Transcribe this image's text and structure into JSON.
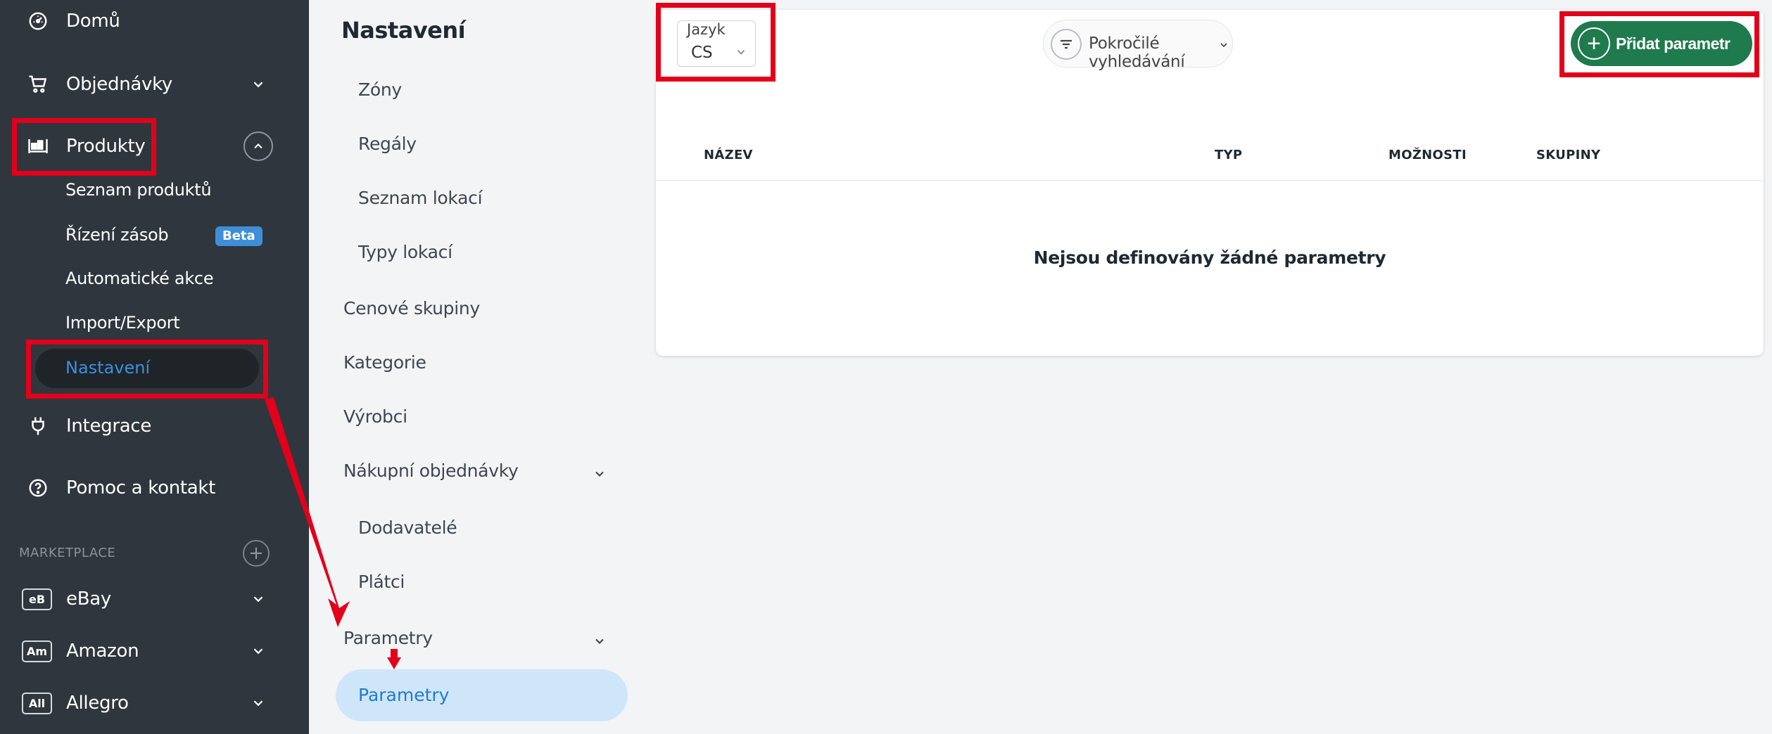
{
  "sidebar": {
    "nav": {
      "home": "Domů",
      "orders": "Objednávky",
      "products": "Produkty",
      "integrations": "Integrace",
      "help": "Pomoc a kontakt"
    },
    "products_sub": {
      "list": "Seznam produktů",
      "stock": "Řízení zásob",
      "stock_badge": "Beta",
      "actions": "Automatické akce",
      "import_export": "Import/Export",
      "settings": "Nastavení"
    },
    "marketplace": {
      "title": "MARKETPLACE",
      "items": [
        {
          "badge": "eB",
          "label": "eBay"
        },
        {
          "badge": "Am",
          "label": "Amazon"
        },
        {
          "badge": "All",
          "label": "Allegro"
        }
      ]
    }
  },
  "settings_nav": {
    "title": "Nastavení",
    "items": {
      "zones": "Zóny",
      "shelves": "Regály",
      "locations_list": "Seznam lokací",
      "location_types": "Typy lokací",
      "price_groups": "Cenové skupiny",
      "categories": "Kategorie",
      "manufacturers": "Výrobci",
      "purchase_orders": "Nákupní objednávky",
      "suppliers": "Dodavatelé",
      "payers": "Plátci",
      "parameters_group": "Parametry",
      "parameters": "Parametry"
    }
  },
  "main": {
    "language": {
      "label": "Jazyk",
      "value": "CS"
    },
    "advanced_search": "Pokročilé vyhledávání",
    "add_button": "Přidat parametr",
    "columns": [
      "NÁZEV",
      "TYP",
      "MOŽNOSTI",
      "SKUPINY"
    ],
    "empty_message": "Nejsou definovány žádné parametry"
  },
  "colors": {
    "sidebar_bg": "#2f363d",
    "active_link": "#3d8fe0",
    "primary_green": "#1f7a4d",
    "highlight_red": "#e2001a",
    "active_item_bg": "#cfe6fa"
  }
}
